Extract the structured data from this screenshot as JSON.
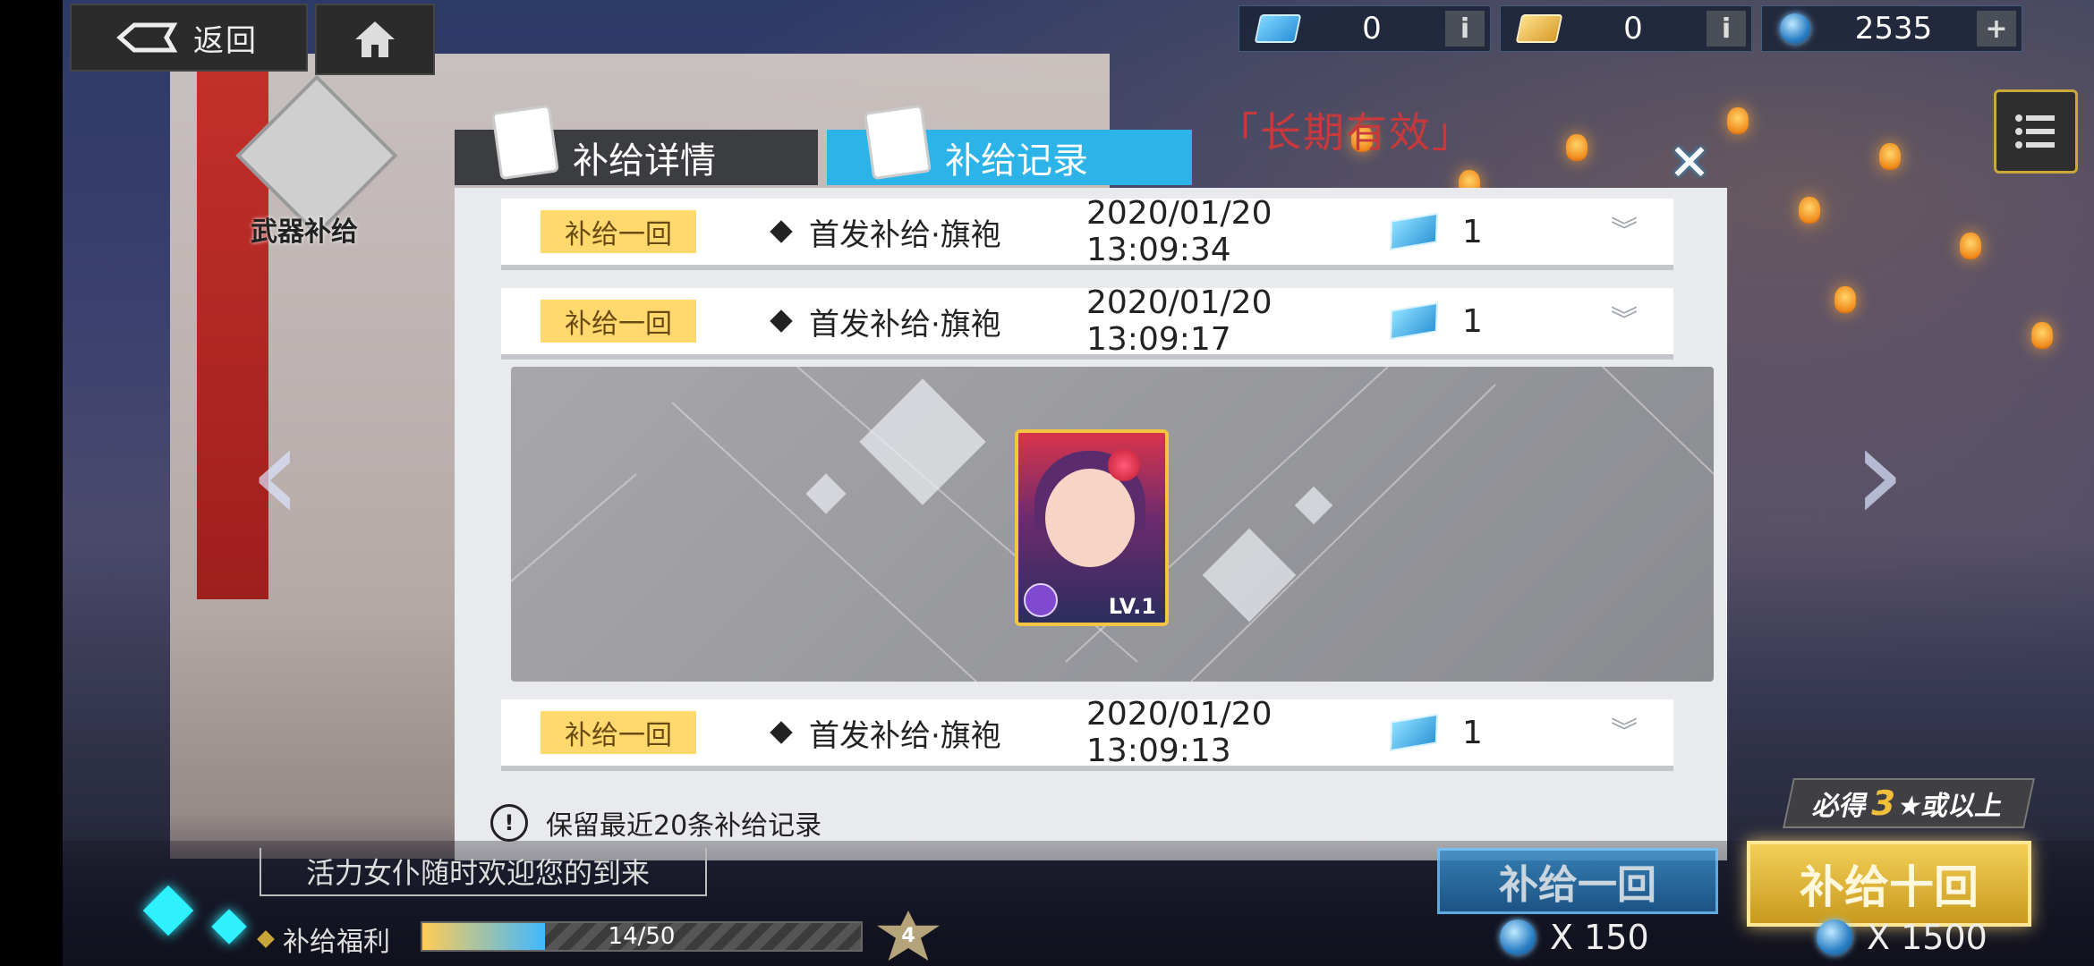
{
  "topbar": {
    "back_label": "返回",
    "resources": [
      {
        "icon": "ticket-blue-icon",
        "value": "0",
        "action": "i"
      },
      {
        "icon": "ticket-gold-icon",
        "value": "0",
        "action": "i"
      },
      {
        "icon": "gem-icon",
        "value": "2535",
        "action": "+"
      }
    ]
  },
  "side": {
    "weapon_supply_label": "武器补给",
    "validity_label": "「长期有效」"
  },
  "modal": {
    "tabs": [
      {
        "label": "补给详情",
        "active": false
      },
      {
        "label": "补给记录",
        "active": true
      }
    ],
    "close_label": "✕",
    "records": [
      {
        "badge": "补给一回",
        "name": "首发补给·旗袍",
        "time": "2020/01/20 13:09:34",
        "qty": "1"
      },
      {
        "badge": "补给一回",
        "name": "首发补给·旗袍",
        "time": "2020/01/20 13:09:17",
        "qty": "1"
      },
      {
        "badge": "补给一回",
        "name": "首发补给·旗袍",
        "time": "2020/01/20 13:09:13",
        "qty": "1"
      }
    ],
    "reward_card": {
      "level": "LV.1"
    },
    "notice": "保留最近20条补给记录"
  },
  "bottom": {
    "welcome": "活力女仆随时欢迎您的到来",
    "welfare_label": "补给福利",
    "progress_text": "14/50",
    "progress_fraction": 0.28,
    "star_badge": "4",
    "guarantee_prefix": "必得",
    "guarantee_num": "3",
    "guarantee_suffix": "★或以上",
    "btn_one_label": "补给一回",
    "btn_ten_label": "补给十回",
    "cost_one": "X 150",
    "cost_ten": "X 1500"
  },
  "colors": {
    "accent": "#2cb3e8",
    "badge": "#ffd86e",
    "gold": "#f3cf58"
  }
}
